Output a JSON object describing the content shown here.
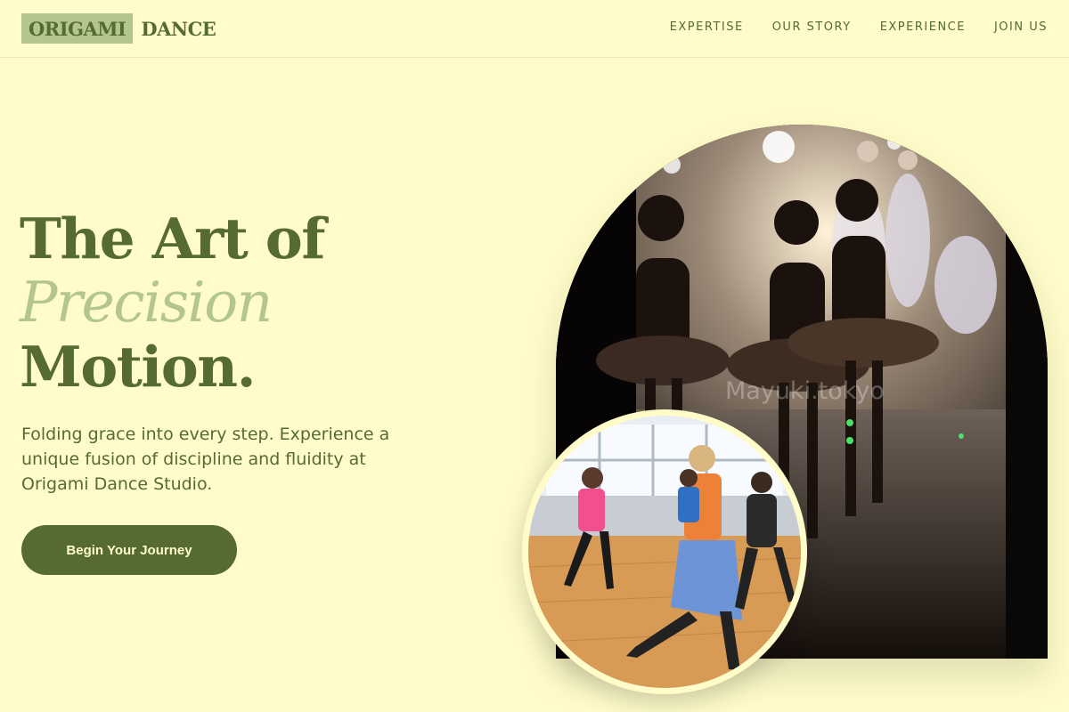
{
  "logo": {
    "box_text": "ORIGAMI",
    "text": "DANCE"
  },
  "nav": [
    {
      "label": "EXPERTISE"
    },
    {
      "label": "OUR STORY"
    },
    {
      "label": "EXPERIENCE"
    },
    {
      "label": "JOIN US"
    }
  ],
  "hero": {
    "title_line1": "The Art of",
    "title_accent": "Precision",
    "title_line3": "Motion.",
    "subtitle": "Folding grace into every step. Experience a unique fusion of discipline and fluidity at Origami Dance Studio.",
    "cta_label": "Begin Your Journey"
  },
  "images": {
    "main": "ballet-backstage-photo",
    "inset": "dance-class-photo",
    "watermark": "Mayuki.tokyo"
  },
  "colors": {
    "background": "#fffcc9",
    "primary": "#556b2f",
    "accent": "#b3c68c"
  }
}
